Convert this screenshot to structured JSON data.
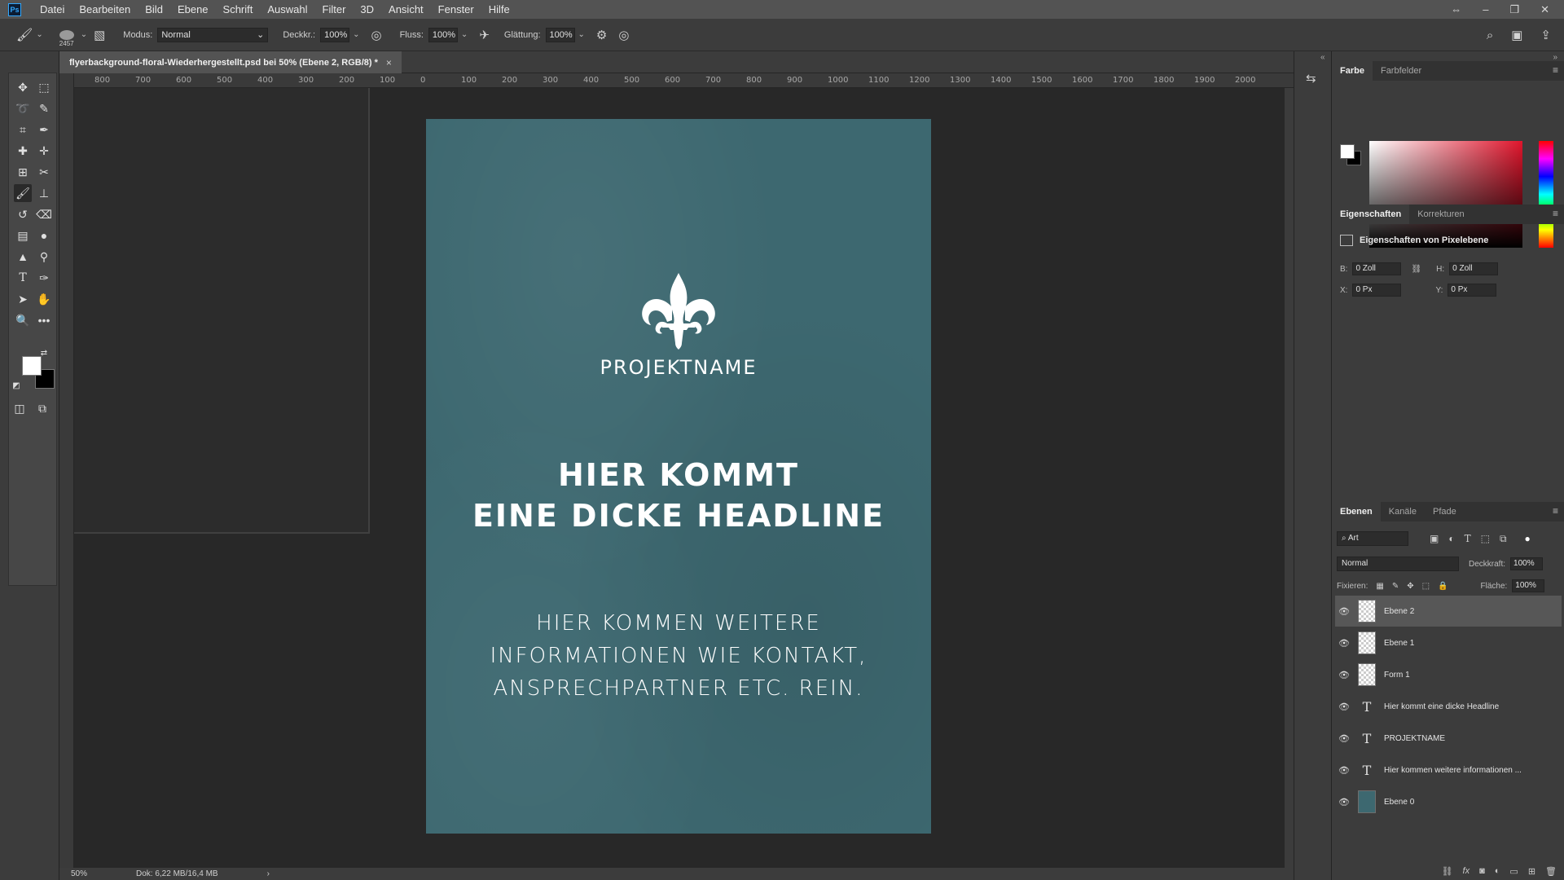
{
  "app": {
    "logo": "Ps"
  },
  "menu": [
    "Datei",
    "Bearbeiten",
    "Bild",
    "Ebene",
    "Schrift",
    "Auswahl",
    "Filter",
    "3D",
    "Ansicht",
    "Fenster",
    "Hilfe"
  ],
  "options": {
    "brush_size": "2457",
    "mode_label": "Modus:",
    "mode_value": "Normal",
    "opacity_label": "Deckkr.:",
    "opacity_value": "100%",
    "flow_label": "Fluss:",
    "flow_value": "100%",
    "smoothing_label": "Glättung:",
    "smoothing_value": "100%"
  },
  "document": {
    "tab_title": "flyerbackground-floral-Wiederhergestellt.psd bei 50% (Ebene 2, RGB/8) *",
    "close_glyph": "×",
    "ruler_labels": [
      "800",
      "700",
      "600",
      "500",
      "400",
      "300",
      "200",
      "100",
      "0",
      "100",
      "200",
      "300",
      "400",
      "500",
      "600",
      "700",
      "800",
      "900",
      "1000",
      "1100",
      "1200",
      "1300",
      "1400",
      "1500",
      "1600",
      "1700",
      "1800",
      "1900",
      "2000"
    ]
  },
  "flyer": {
    "project_name": "PROJEKTNAME",
    "headline_line1": "HIER KOMMT",
    "headline_line2": "EINE DICKE HEADLINE",
    "info_line1": "HIER KOMMEN WEITERE",
    "info_line2": "INFORMATIONEN WIE KONTAKT,",
    "info_line3": "ANSPRECHPARTNER ETC. REIN."
  },
  "status": {
    "zoom": "50%",
    "doc_info": "Dok: 6,22 MB/16,4 MB",
    "arrow": "›"
  },
  "panels": {
    "color_tabs": [
      "Farbe",
      "Farbfelder"
    ],
    "props_tabs": [
      "Eigenschaften",
      "Korrekturen"
    ],
    "props_title": "Eigenschaften von Pixelebene",
    "props": {
      "b_label": "B:",
      "b_value": "0 Zoll",
      "h_label": "H:",
      "h_value": "0 Zoll",
      "x_label": "X:",
      "x_value": "0 Px",
      "y_label": "Y:",
      "y_value": "0 Px"
    },
    "layer_tabs": [
      "Ebenen",
      "Kanäle",
      "Pfade"
    ],
    "filter_kind": "Art",
    "blend_mode": "Normal",
    "opacity_label": "Deckkraft:",
    "opacity_value": "100%",
    "lock_label": "Fixieren:",
    "fill_label": "Fläche:",
    "fill_value": "100%"
  },
  "layers": [
    {
      "name": "Ebene 2",
      "kind": "pixel",
      "selected": true
    },
    {
      "name": "Ebene 1",
      "kind": "pixel",
      "selected": false
    },
    {
      "name": "Form 1",
      "kind": "shape",
      "selected": false
    },
    {
      "name": "Hier kommt eine dicke Headline",
      "kind": "text",
      "selected": false
    },
    {
      "name": "PROJEKTNAME",
      "kind": "text",
      "selected": false
    },
    {
      "name": "Hier kommen weitere informationen ...",
      "kind": "text",
      "selected": false
    },
    {
      "name": "Ebene 0",
      "kind": "fill",
      "selected": false
    }
  ],
  "colors": {
    "flyer_bg": "#3d6870",
    "ui_dark": "#3c3c3c",
    "canvas_bg": "#282828"
  }
}
